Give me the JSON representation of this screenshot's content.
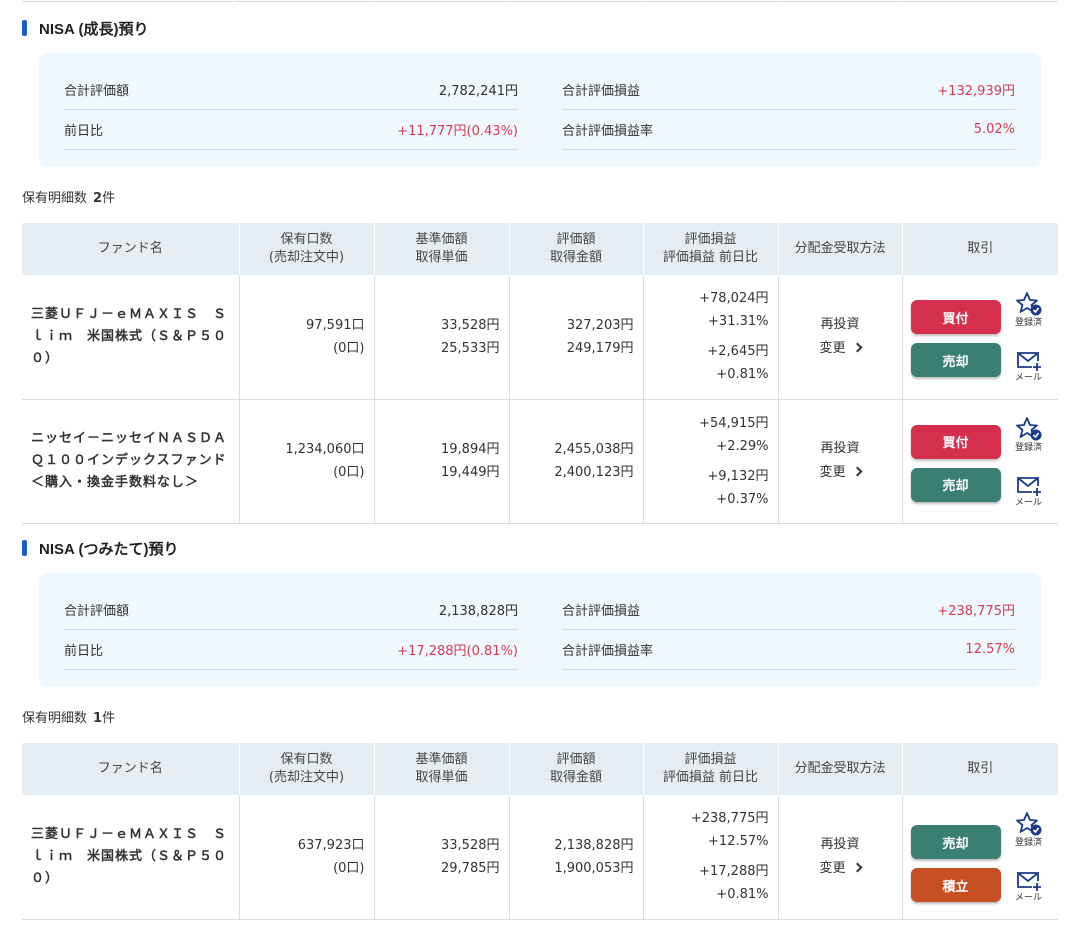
{
  "sections": [
    {
      "title": "NISA (成長)預り",
      "summary": {
        "total_value_label": "合計評価額",
        "total_value": "2,782,241円",
        "total_pl_label": "合計評価損益",
        "total_pl": "+132,939円",
        "day_change_label": "前日比",
        "day_change": "+11,777円(0.43%)",
        "pl_rate_label": "合計評価損益率",
        "pl_rate": "5.02%"
      },
      "count_label": "保有明細数",
      "count_value": "2",
      "count_unit": "件",
      "funds": [
        {
          "name": "三菱ＵＦＪ－ｅＭＡＸＩＳ　Ｓｌｉｍ　米国株式（Ｓ＆Ｐ５００）",
          "units": "97,591口",
          "units_pending": "(0口)",
          "base_price": "33,528円",
          "acq_price": "25,533円",
          "value": "327,203円",
          "acq_amount": "249,179円",
          "pl": "+78,024円",
          "pl_pct": "+31.31%",
          "pl_day": "+2,645円",
          "pl_day_pct": "+0.81%",
          "dist": "再投資",
          "dist_change": "変更",
          "btn1": "買付",
          "btn2": "売却",
          "icon1_caption": "登録済",
          "icon2_caption": "メール"
        },
        {
          "name": "ニッセイ－ニッセイＮＡＳＤＡＱ１００インデックスファンド＜購入・換金手数料なし＞",
          "units": "1,234,060口",
          "units_pending": "(0口)",
          "base_price": "19,894円",
          "acq_price": "19,449円",
          "value": "2,455,038円",
          "acq_amount": "2,400,123円",
          "pl": "+54,915円",
          "pl_pct": "+2.29%",
          "pl_day": "+9,132円",
          "pl_day_pct": "+0.37%",
          "dist": "再投資",
          "dist_change": "変更",
          "btn1": "買付",
          "btn2": "売却",
          "icon1_caption": "登録済",
          "icon2_caption": "メール"
        }
      ]
    },
    {
      "title": "NISA (つみたて)預り",
      "summary": {
        "total_value_label": "合計評価額",
        "total_value": "2,138,828円",
        "total_pl_label": "合計評価損益",
        "total_pl": "+238,775円",
        "day_change_label": "前日比",
        "day_change": "+17,288円(0.81%)",
        "pl_rate_label": "合計評価損益率",
        "pl_rate": "12.57%"
      },
      "count_label": "保有明細数",
      "count_value": "1",
      "count_unit": "件",
      "funds": [
        {
          "name": "三菱ＵＦＪ－ｅＭＡＸＩＳ　Ｓｌｉｍ　米国株式（Ｓ＆Ｐ５００）",
          "units": "637,923口",
          "units_pending": "(0口)",
          "base_price": "33,528円",
          "acq_price": "29,785円",
          "value": "2,138,828円",
          "acq_amount": "1,900,053円",
          "pl": "+238,775円",
          "pl_pct": "+12.57%",
          "pl_day": "+17,288円",
          "pl_day_pct": "+0.81%",
          "dist": "再投資",
          "dist_change": "変更",
          "btn1": "売却",
          "btn2": "積立",
          "icon1_caption": "登録済",
          "icon2_caption": "メール"
        }
      ]
    }
  ],
  "table_headers": {
    "fund_name": "ファンド名",
    "units_1": "保有口数",
    "units_2": "(売却注文中)",
    "price_1": "基準価額",
    "price_2": "取得単価",
    "value_1": "評価額",
    "value_2": "取得金額",
    "pl_1": "評価損益",
    "pl_2": "評価損益 前日比",
    "dist": "分配金受取方法",
    "trade": "取引"
  },
  "colors": {
    "accent_bar": "#1e5bc6",
    "fund_name": "#1a3a8a",
    "positive": "#d83a55",
    "buy_button": "#d4304d",
    "sell_button": "#3b7f73",
    "tsumitate_button": "#c84e24",
    "summary_bg": "#eef8fd",
    "table_header_bg": "#e6edf2"
  },
  "icons": {
    "star_check": "star-check-icon",
    "mail_plus": "mail-plus-icon",
    "chevron": "chevron-right-icon"
  }
}
